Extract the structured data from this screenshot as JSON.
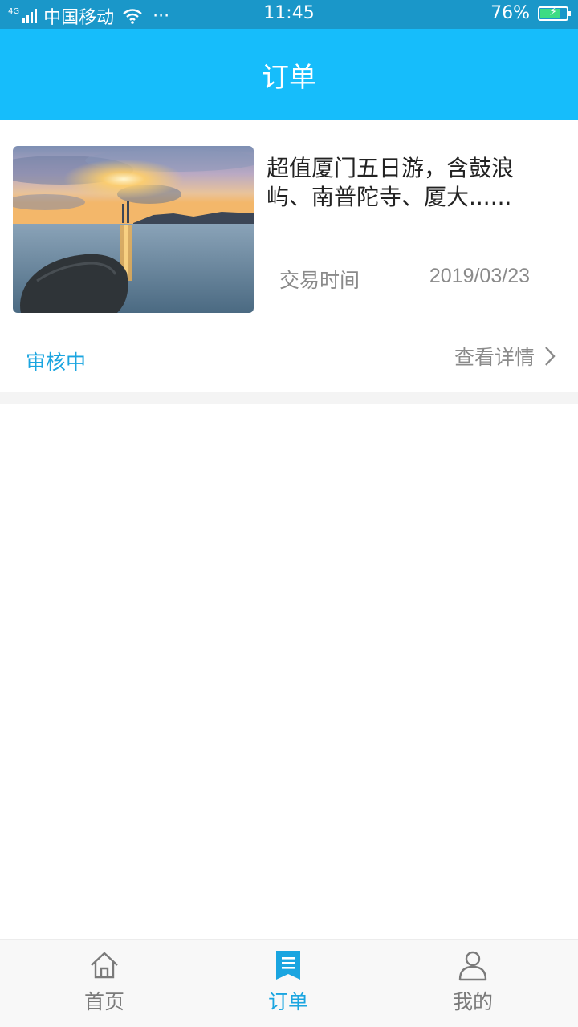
{
  "status_bar": {
    "network": "4G",
    "carrier": "中国移动",
    "more": "···",
    "time": "11:45",
    "battery_percent": "76%",
    "battery_level": 0.76
  },
  "header": {
    "title": "订单"
  },
  "order": {
    "title": "超值厦门五日游，含鼓浪屿、南普陀寺、厦大......",
    "trade_label": "交易时间",
    "trade_date": "2019/03/23",
    "status": "审核中",
    "detail_link": "查看详情",
    "image_icon": "sunset-seascape-photo"
  },
  "tabs": [
    {
      "label": "首页",
      "icon": "home-icon",
      "active": false
    },
    {
      "label": "订单",
      "icon": "order-icon",
      "active": true
    },
    {
      "label": "我的",
      "icon": "user-icon",
      "active": false
    }
  ],
  "colors": {
    "status_bar": "#1a97c9",
    "header": "#16bdfb",
    "accent": "#1aa5e0",
    "muted_text": "#8a8a8a"
  }
}
